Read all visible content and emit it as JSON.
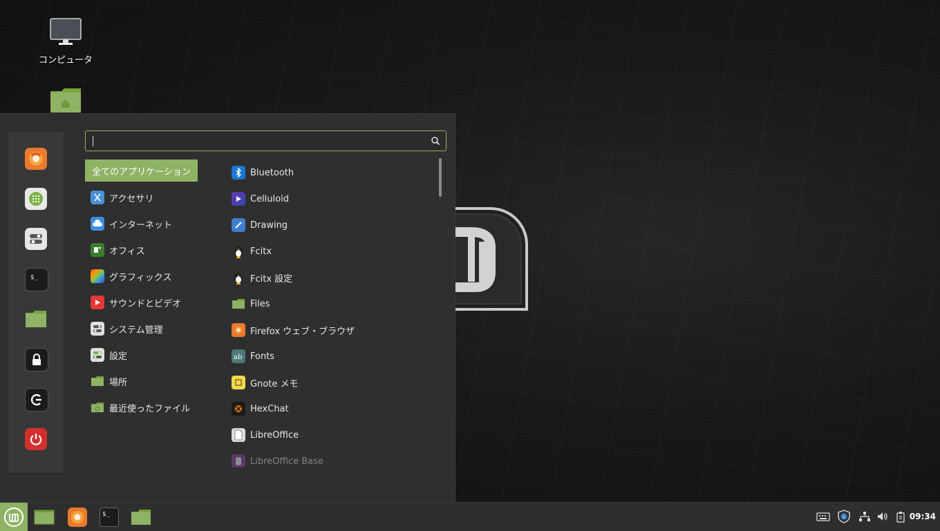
{
  "desktop": {
    "icons": [
      {
        "label": "コンピュータ"
      },
      {
        "label": ""
      }
    ]
  },
  "menu": {
    "search": {
      "value": "",
      "placeholder": ""
    },
    "favorites": [
      {
        "icon": "firefox-icon"
      },
      {
        "icon": "software-manager-icon"
      },
      {
        "icon": "system-settings-icon"
      },
      {
        "icon": "terminal-icon"
      },
      {
        "icon": "files-icon"
      },
      {
        "icon": "lock-screen-icon"
      },
      {
        "icon": "logout-icon"
      },
      {
        "icon": "power-icon"
      }
    ],
    "categories": [
      {
        "label": "全てのアプリケーション"
      },
      {
        "label": "アクセサリ"
      },
      {
        "label": "インターネット"
      },
      {
        "label": "オフィス"
      },
      {
        "label": "グラフィックス"
      },
      {
        "label": "サウンドとビデオ"
      },
      {
        "label": "システム管理"
      },
      {
        "label": "設定"
      },
      {
        "label": "場所"
      },
      {
        "label": "最近使ったファイル"
      }
    ],
    "apps": [
      {
        "label": "Bluetooth"
      },
      {
        "label": "Celluloid"
      },
      {
        "label": "Drawing"
      },
      {
        "label": "Fcitx"
      },
      {
        "label": "Fcitx 設定"
      },
      {
        "label": "Files"
      },
      {
        "label": "Firefox ウェブ・ブラウザ"
      },
      {
        "label": "Fonts"
      },
      {
        "label": "Gnote メモ"
      },
      {
        "label": "HexChat"
      },
      {
        "label": "LibreOffice"
      },
      {
        "label": "LibreOffice Base"
      }
    ]
  },
  "panel": {
    "clock": "09:34",
    "colors": {
      "accent": "#8fb365",
      "panel": "#2e2e2e",
      "menu": "#2f2f2f"
    }
  }
}
